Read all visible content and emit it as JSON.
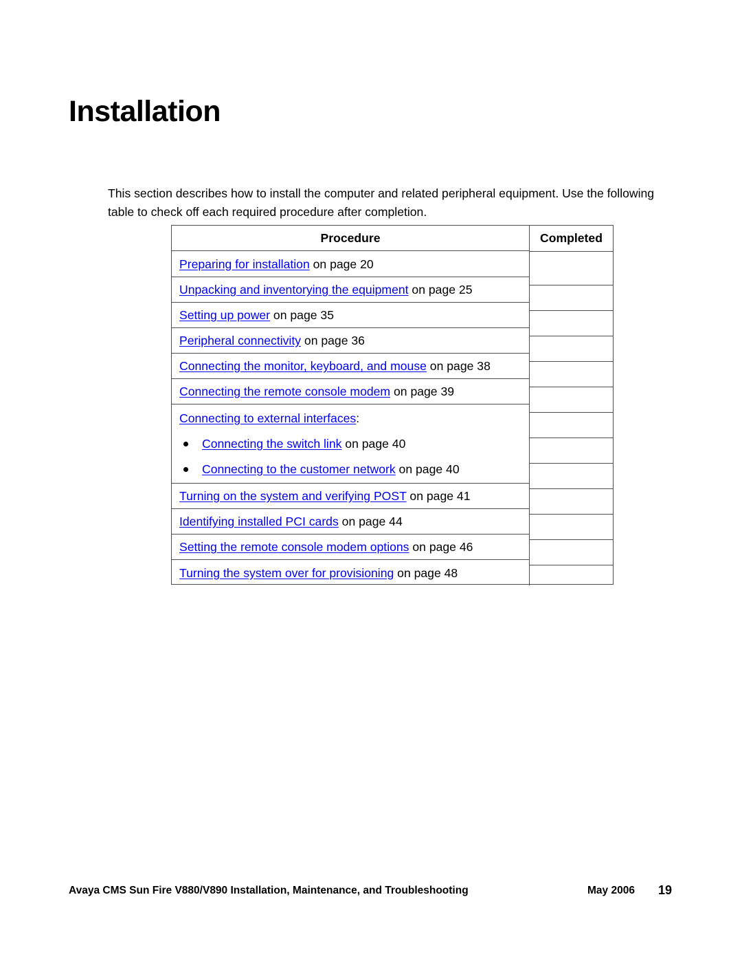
{
  "page": {
    "title": "Installation",
    "intro": "This section describes how to install the computer and related peripheral equipment. Use the following table to check off each required procedure after completion."
  },
  "table": {
    "headers": {
      "procedure": "Procedure",
      "completed": "Completed"
    },
    "rows": [
      {
        "link": "Preparing for installation",
        "suffix": " on page 20"
      },
      {
        "link": "Unpacking and inventorying the equipment",
        "suffix": " on page 25"
      },
      {
        "link": "Setting up power",
        "suffix": " on page 35"
      },
      {
        "link": "Peripheral connectivity",
        "suffix": " on page 36"
      },
      {
        "link": "Connecting the monitor, keyboard, and mouse",
        "suffix": " on page 38"
      },
      {
        "link": "Connecting the remote console modem",
        "suffix": " on page 39"
      }
    ],
    "group": {
      "link": "Connecting to external interfaces",
      "suffix": ":",
      "bullets": [
        {
          "link": "Connecting the switch link",
          "suffix": " on page 40"
        },
        {
          "link": "Connecting to the customer network",
          "suffix": " on page 40"
        }
      ]
    },
    "rows_after": [
      {
        "link": "Turning on the system and verifying POST",
        "suffix": " on page 41"
      },
      {
        "link": "Identifying installed PCI cards",
        "suffix": " on page 44"
      },
      {
        "link": "Setting the remote console modem options",
        "suffix": " on page 46"
      },
      {
        "link": "Turning the system over for provisioning",
        "suffix": " on page 48"
      }
    ],
    "link_color": "#0000EE",
    "border_color": "#4D4D4D"
  },
  "footer": {
    "doc_title": "Avaya CMS Sun Fire V880/V890 Installation, Maintenance, and Troubleshooting",
    "date": "May 2006",
    "page_number": "19"
  }
}
